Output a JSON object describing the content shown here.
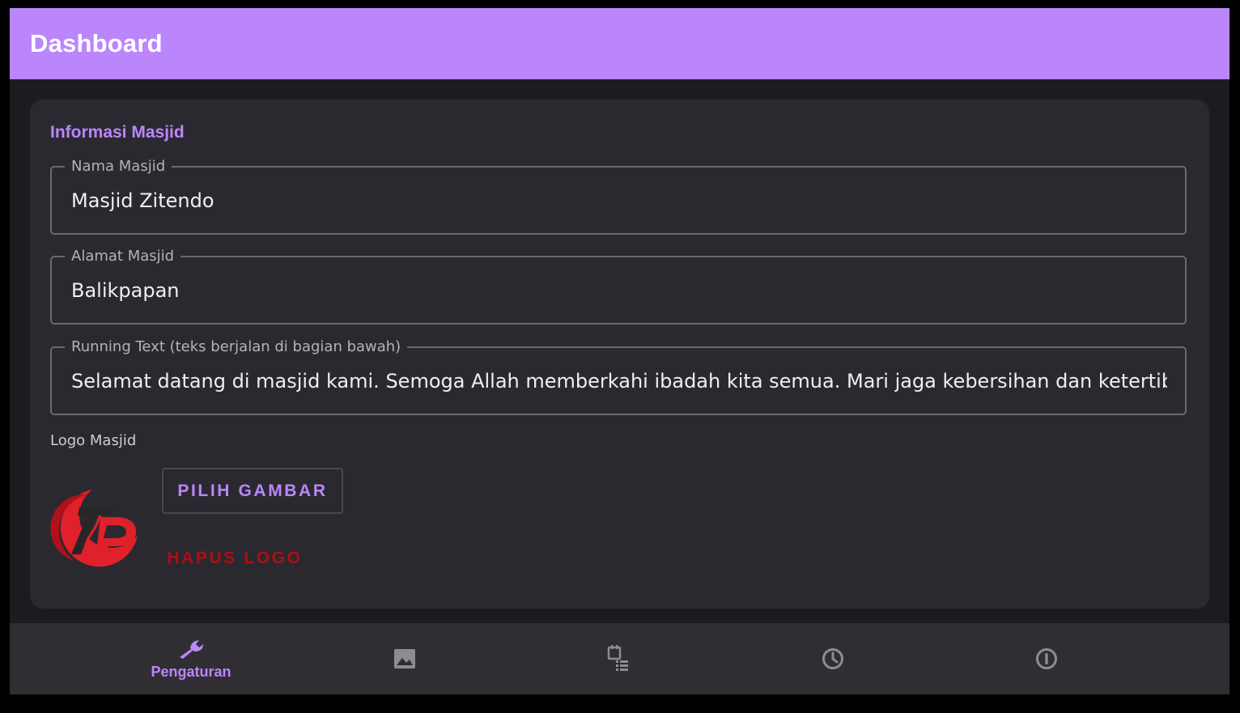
{
  "appbar": {
    "title": "Dashboard"
  },
  "card": {
    "title": "Informasi Masjid",
    "fields": [
      {
        "label": "Nama Masjid",
        "value": "Masjid Zitendo"
      },
      {
        "label": "Alamat Masjid",
        "value": "Balikpapan"
      },
      {
        "label": "Running Text (teks berjalan di bagian bawah)",
        "value": "Selamat datang di masjid kami. Semoga Allah memberkahi ibadah kita semua. Mari jaga kebersihan dan ketertiban masjid"
      }
    ],
    "logo_label": "Logo Masjid",
    "pick_image_label": "PILIH GAMBAR",
    "remove_logo_label": "HAPUS LOGO"
  },
  "bottom_nav": {
    "items": [
      {
        "icon": "wrench-icon",
        "label": "Pengaturan",
        "selected": true
      },
      {
        "icon": "image-icon",
        "selected": false
      },
      {
        "icon": "calendar-list-icon",
        "selected": false
      },
      {
        "icon": "clock-icon",
        "selected": false
      },
      {
        "icon": "info-icon",
        "selected": false
      }
    ]
  },
  "colors": {
    "accent": "#bb86fc",
    "background": "#1c1b1f",
    "card": "#2b2930",
    "danger": "#b00d15",
    "nav_inactive": "#8e8b92"
  }
}
